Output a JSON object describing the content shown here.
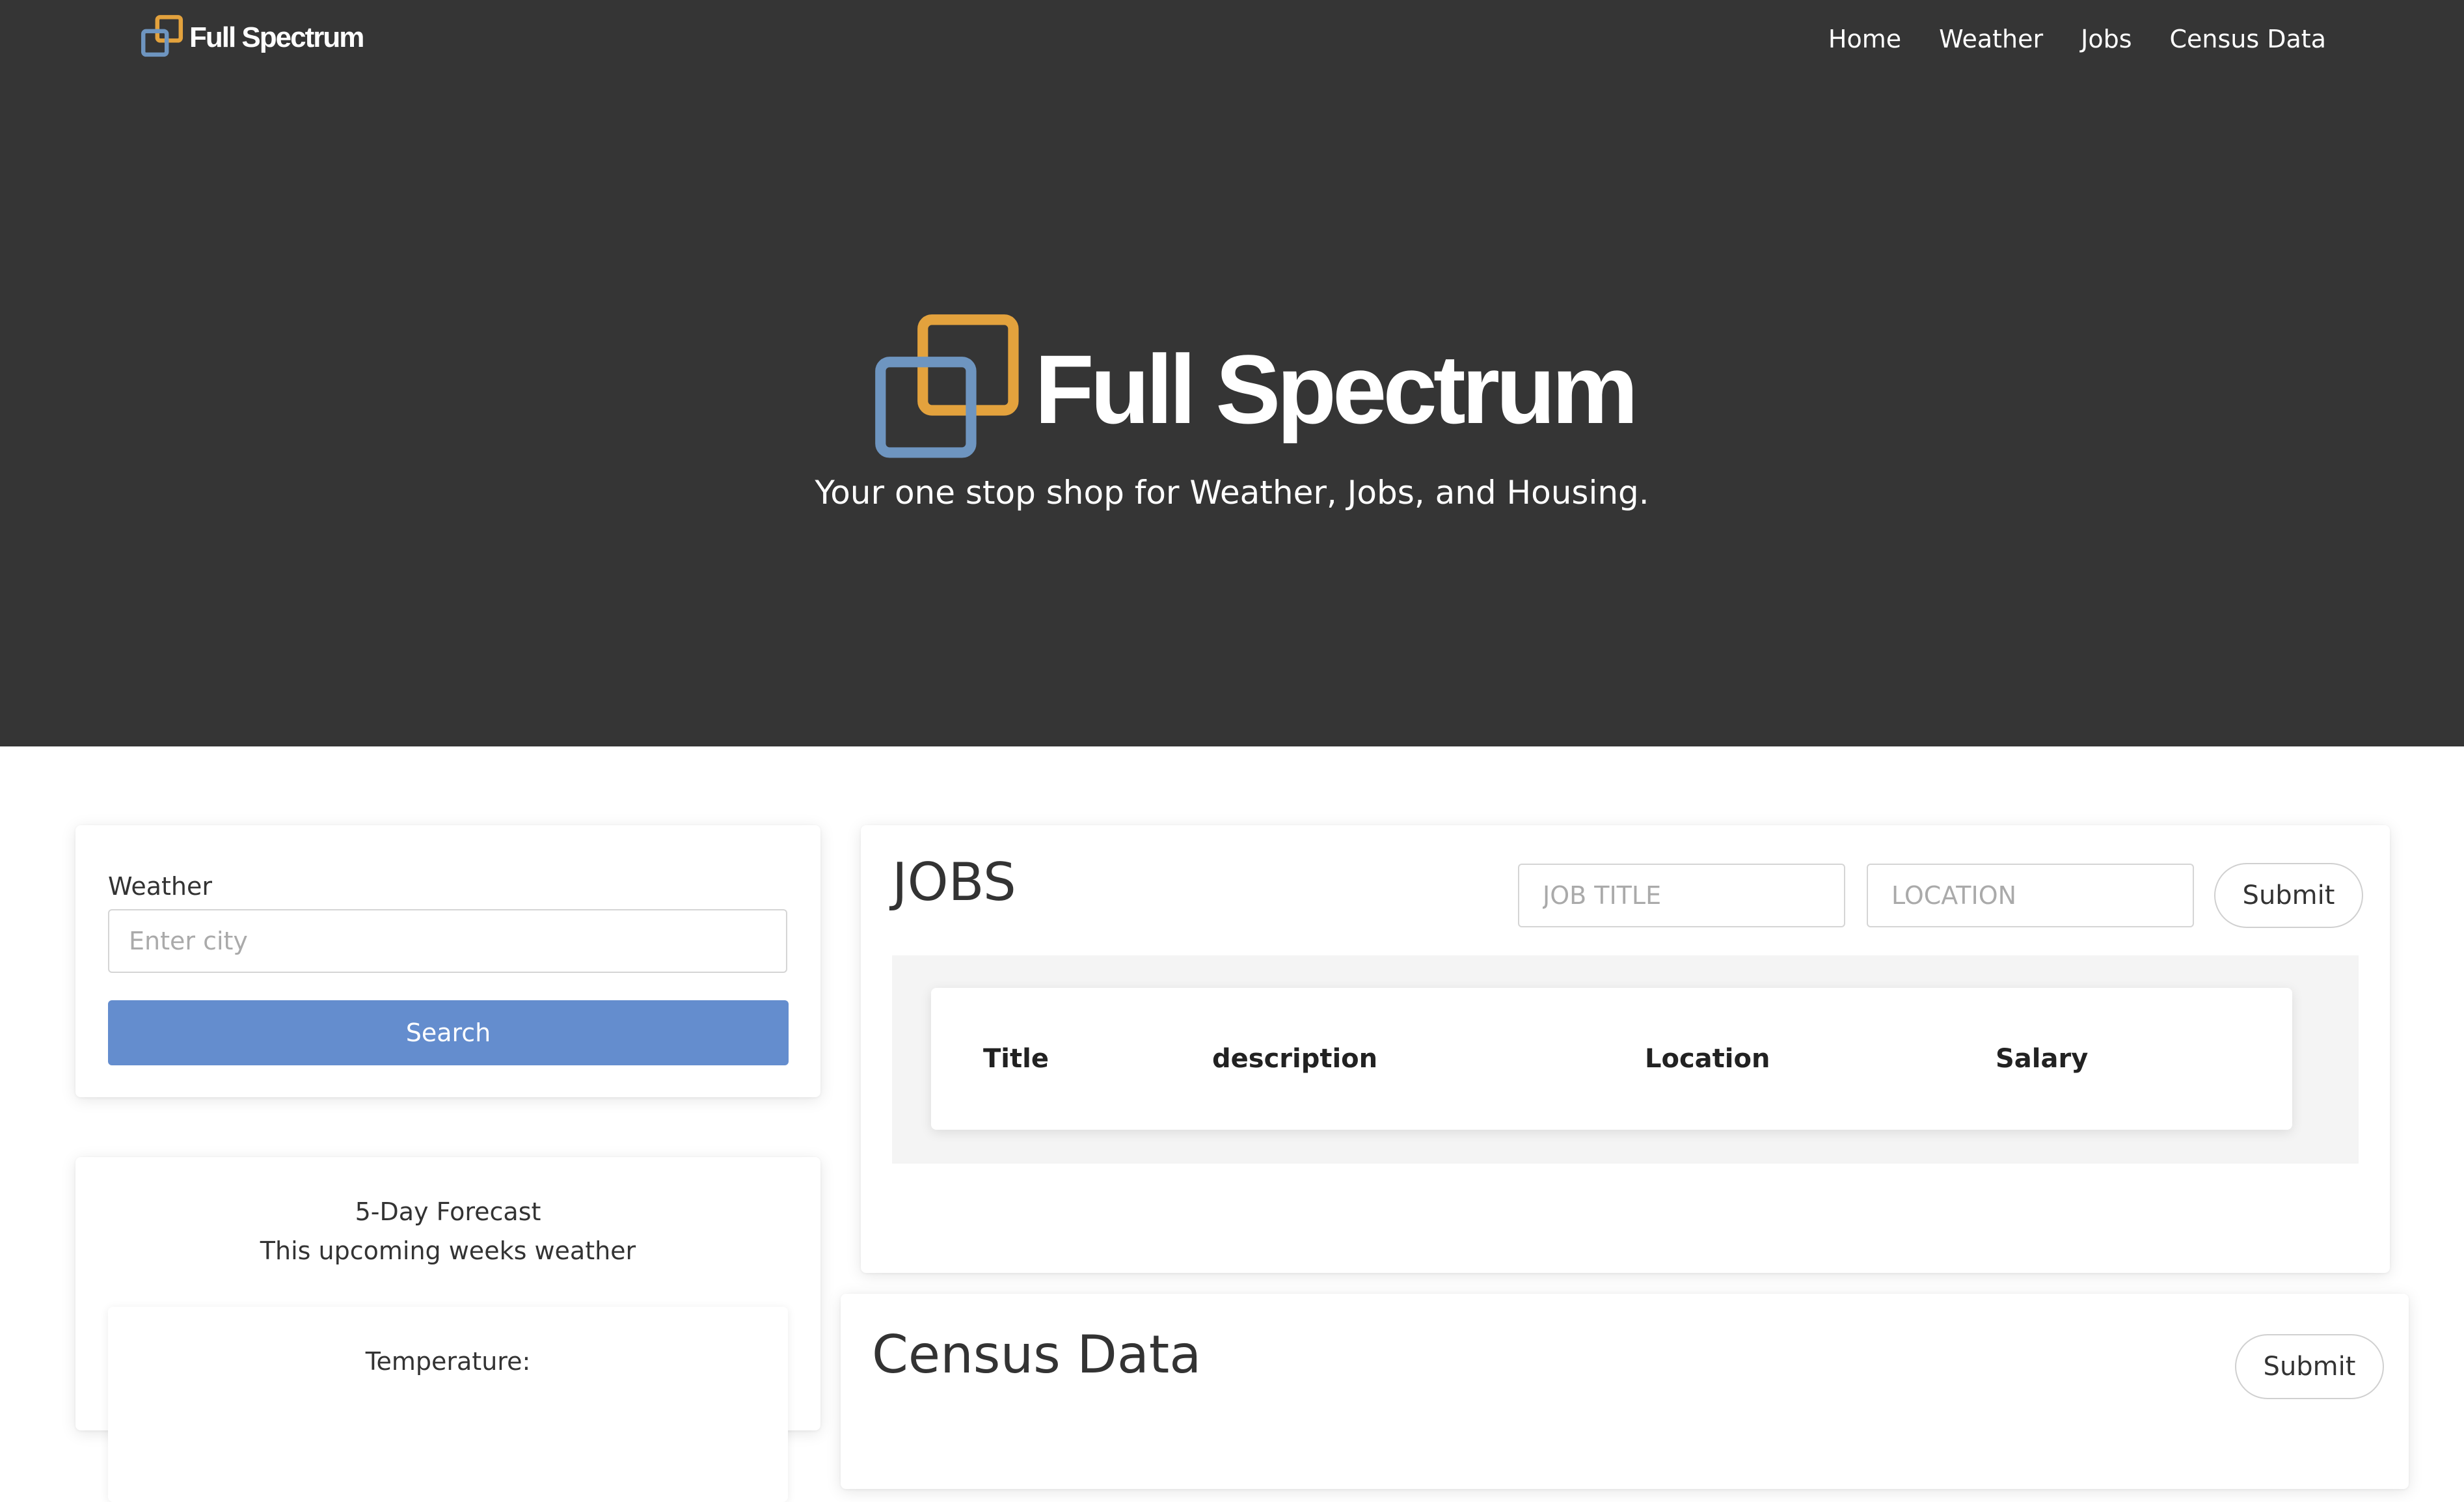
{
  "nav": {
    "brand": "Full Spectrum",
    "links": [
      "Home",
      "Weather",
      "Jobs",
      "Census Data"
    ]
  },
  "hero": {
    "logo_text": "Full Spectrum",
    "tagline": "Your one stop shop for Weather, Jobs, and Housing."
  },
  "weather": {
    "label": "Weather",
    "city_placeholder": "Enter city",
    "search_label": "Search"
  },
  "forecast": {
    "title": "5-Day Forecast",
    "subtitle": "This upcoming weeks weather",
    "temperature_label": "Temperature:"
  },
  "jobs": {
    "heading": "JOBS",
    "title_placeholder": "JOB TITLE",
    "location_placeholder": "LOCATION",
    "submit_label": "Submit",
    "columns": [
      "Title",
      "description",
      "Location",
      "Salary"
    ]
  },
  "census": {
    "heading": "Census Data",
    "submit_label": "Submit"
  },
  "colors": {
    "hero_bg": "#353535",
    "logo_orange": "#e3a23d",
    "logo_blue": "#6e95c0",
    "search_button": "#648dce"
  },
  "icons": {
    "brand_logo": "overlapping-squares-logo-icon"
  }
}
